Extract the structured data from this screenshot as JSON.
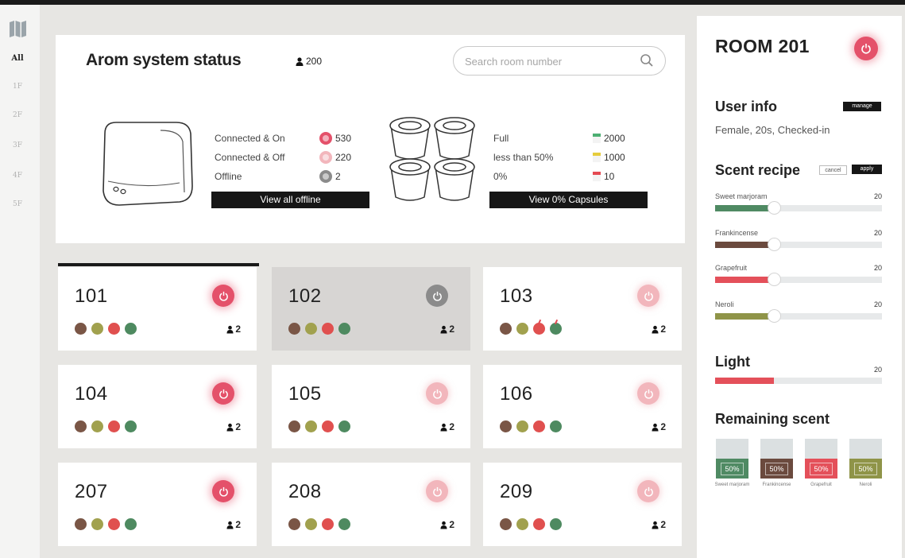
{
  "nav": {
    "floors": [
      "All",
      "1F",
      "2F",
      "3F",
      "4F",
      "5F"
    ],
    "active_floor": "All"
  },
  "header": {
    "title": "Arom system status",
    "total_users": "200",
    "search_placeholder": "Search room number"
  },
  "devices": {
    "rows": [
      {
        "label": "Connected & On",
        "value": "530",
        "color": "#e4516a"
      },
      {
        "label": "Connected & Off",
        "value": "220",
        "color": "#f2b6bc"
      },
      {
        "label": "Offline",
        "value": "2",
        "color": "#8b8b8b"
      }
    ],
    "button": "View all offline"
  },
  "capsules": {
    "rows": [
      {
        "label": "Full",
        "value": "2000",
        "color": "#4caf72"
      },
      {
        "label": "less than 50%",
        "value": "1000",
        "color": "#e5cc3c"
      },
      {
        "label": "0%",
        "value": "10",
        "color": "#e44a52"
      }
    ],
    "button": "View 0% Capsules"
  },
  "colors": {
    "power_on": "#e4516a",
    "power_off": "#f2b6bc",
    "power_offline": "#8b8b8b",
    "scent_1": "#4f8a63",
    "scent_2": "#6b4a3e",
    "scent_3": "#e4505a",
    "scent_4": "#8f9448",
    "dot_brown": "#7a5646",
    "dot_olive": "#a1a14e",
    "dot_red": "#e0504f",
    "dot_green": "#4e8a60"
  },
  "rooms": [
    {
      "number": "101",
      "power": "on",
      "occupants": "2"
    },
    {
      "number": "102",
      "power": "offline",
      "occupants": "2"
    },
    {
      "number": "103",
      "power": "off",
      "occupants": "2"
    },
    {
      "number": "104",
      "power": "on",
      "occupants": "2"
    },
    {
      "number": "105",
      "power": "off",
      "occupants": "2"
    },
    {
      "number": "106",
      "power": "off",
      "occupants": "2"
    },
    {
      "number": "207",
      "power": "on",
      "occupants": "2"
    },
    {
      "number": "208",
      "power": "off",
      "occupants": "2"
    },
    {
      "number": "209",
      "power": "off",
      "occupants": "2"
    }
  ],
  "room_detail": {
    "title": "ROOM 201",
    "user_info_heading": "User info",
    "manage_label": "manage",
    "user_description": "Female, 20s, Checked-in",
    "scent_heading": "Scent recipe",
    "cancel_label": "cancel",
    "apply_label": "apply",
    "scents": [
      {
        "name": "Sweet marjoram",
        "value": "20",
        "level": 0.35
      },
      {
        "name": "Frankincense",
        "value": "20",
        "level": 0.35
      },
      {
        "name": "Grapefruit",
        "value": "20",
        "level": 0.35
      },
      {
        "name": "Neroli",
        "value": "20",
        "level": 0.35
      }
    ],
    "light_heading": "Light",
    "light_value": "20",
    "light_level": 0.35,
    "remaining_heading": "Remaining scent",
    "remaining": [
      {
        "name": "Sweet marjoram",
        "percent": "50%",
        "level": 0.5
      },
      {
        "name": "Frankincense",
        "percent": "50%",
        "level": 0.5
      },
      {
        "name": "Grapefruit",
        "percent": "50%",
        "level": 0.5
      },
      {
        "name": "Neroli",
        "percent": "50%",
        "level": 0.5
      }
    ]
  }
}
